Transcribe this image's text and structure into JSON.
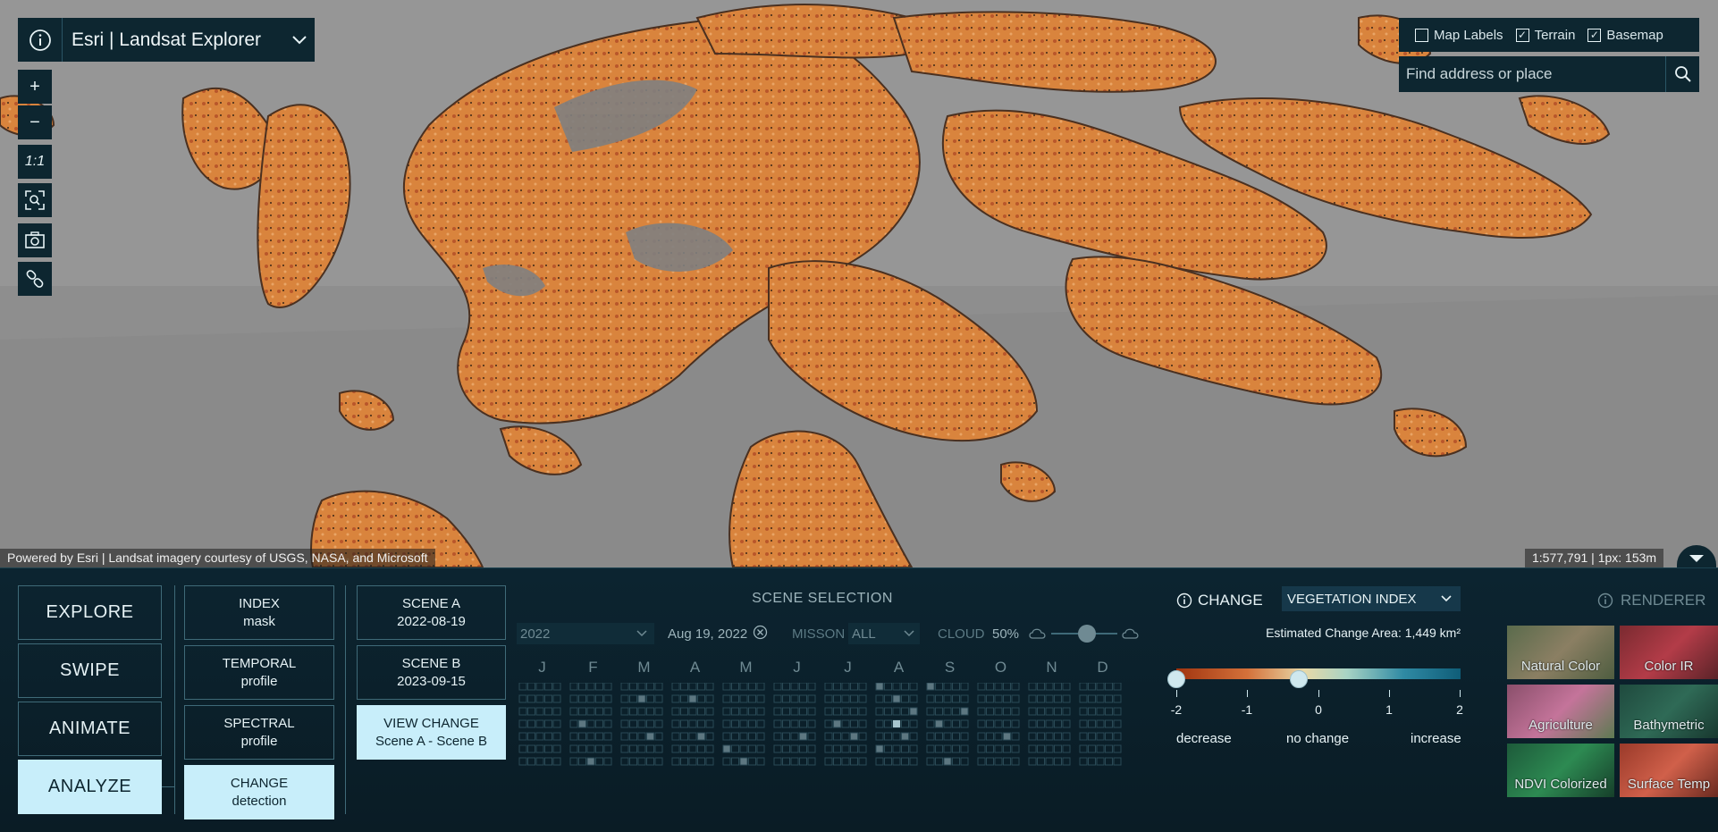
{
  "app": {
    "title": "Esri | Landsat Explorer"
  },
  "map": {
    "layer_toggles": [
      {
        "label": "Map Labels",
        "checked": false
      },
      {
        "label": "Terrain",
        "checked": true
      },
      {
        "label": "Basemap",
        "checked": true
      }
    ],
    "search": {
      "placeholder": "Find address or place"
    },
    "tools": {
      "zoom_in": "+",
      "zoom_out": "−",
      "one_to_one": "1:1"
    },
    "attribution": "Powered by Esri | Landsat imagery courtesy of USGS, NASA, and Microsoft",
    "scale": "1:577,791 | 1px: 153m"
  },
  "modes": [
    "EXPLORE",
    "SWIPE",
    "ANIMATE",
    "ANALYZE"
  ],
  "active_mode": "ANALYZE",
  "analyze_tools": [
    {
      "line1": "INDEX",
      "line2": "mask"
    },
    {
      "line1": "TEMPORAL",
      "line2": "profile"
    },
    {
      "line1": "SPECTRAL",
      "line2": "profile"
    },
    {
      "line1": "CHANGE",
      "line2": "detection"
    }
  ],
  "scenes": {
    "a_label": "SCENE A",
    "a_date": "2022-08-19",
    "b_label": "SCENE B",
    "b_date": "2023-09-15",
    "view_line1": "VIEW CHANGE",
    "view_line2": "Scene A - Scene B"
  },
  "scene_selection": {
    "title": "SCENE SELECTION",
    "year": "2022",
    "date": "Aug 19, 2022",
    "mission_label": "MISSON",
    "mission_value": "ALL",
    "cloud_label": "CLOUD",
    "cloud_value": "50%",
    "months": [
      "J",
      "F",
      "M",
      "A",
      "M",
      "J",
      "J",
      "A",
      "S",
      "O",
      "N",
      "D"
    ]
  },
  "change": {
    "header": "CHANGE",
    "index": "VEGETATION INDEX",
    "estimated_area": "Estimated Change Area: 1,449 km²",
    "ticks": [
      "-2",
      "-1",
      "0",
      "1",
      "2"
    ],
    "decrease": "decrease",
    "no_change": "no change",
    "increase": "increase",
    "handle_values": [
      -2,
      -0.33
    ]
  },
  "renderers": {
    "header": "RENDERER",
    "items": [
      "Natural Color",
      "Color IR",
      "Agriculture",
      "Bathymetric",
      "NDVI Colorized",
      "Surface Temp"
    ]
  },
  "colors": {
    "panel": "#0d2630",
    "active": "#c8eefa",
    "change_orange": "#d9843d",
    "change_dark": "#b9562a"
  }
}
